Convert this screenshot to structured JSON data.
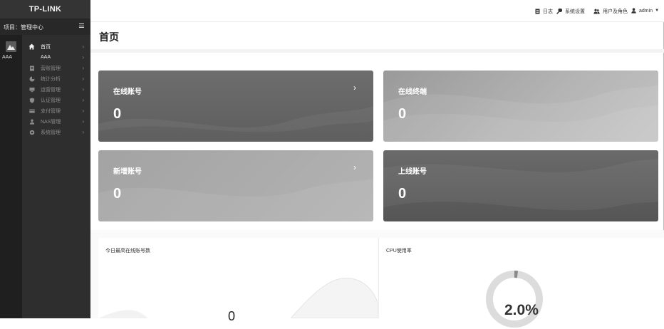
{
  "brand": {
    "logo_text": "TP-LINK"
  },
  "project": {
    "label": "项目：管理中心"
  },
  "rail": {
    "label": "AAA"
  },
  "nav": {
    "items": [
      {
        "label": "首页",
        "icon": "home-icon"
      },
      {
        "label": "AAA",
        "icon": ""
      },
      {
        "label": "营账管理",
        "icon": "clipboard-icon"
      },
      {
        "label": "统计分析",
        "icon": "pie-chart-icon"
      },
      {
        "label": "运营管理",
        "icon": "monitor-icon"
      },
      {
        "label": "认证管理",
        "icon": "shield-icon"
      },
      {
        "label": "支付管理",
        "icon": "card-icon"
      },
      {
        "label": "NAS管理",
        "icon": "users-icon"
      },
      {
        "label": "系统管理",
        "icon": "gear-icon"
      }
    ]
  },
  "topbar": {
    "log": "日志",
    "settings": "系统设置",
    "users": "用户及角色",
    "account": "admin"
  },
  "page": {
    "title": "首页"
  },
  "cards": [
    {
      "label": "在线账号",
      "value": "0"
    },
    {
      "label": "在线终端",
      "value": "0"
    },
    {
      "label": "新增账号",
      "value": "0"
    },
    {
      "label": "上线账号",
      "value": "0"
    }
  ],
  "panels": {
    "peak": {
      "title": "今日最高在线账号数",
      "value": "0"
    },
    "cpu": {
      "title": "CPU使用率",
      "value": "2.0%",
      "fraction": 0.02
    }
  },
  "colors": {
    "sidebar": "#2e2e2e",
    "rail": "#1f1f1f",
    "card_dark": "#626262",
    "card_light": "#b0b0b0"
  }
}
